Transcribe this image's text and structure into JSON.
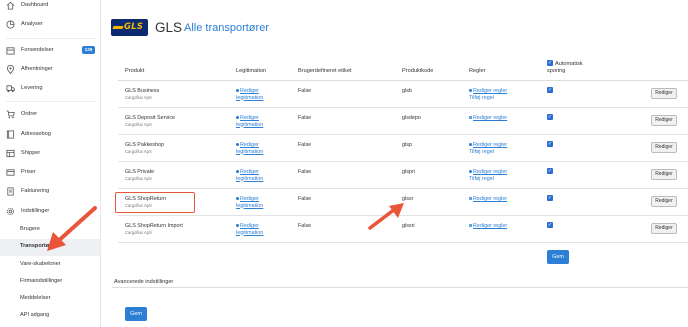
{
  "sidebar": {
    "items": [
      {
        "label": "Dashboard",
        "icon": "home-icon"
      },
      {
        "label": "Analyser",
        "icon": "chart-icon"
      },
      {
        "label": "Forsendelser",
        "icon": "box-icon",
        "badge": "129"
      },
      {
        "label": "Afhentninger",
        "icon": "pin-icon"
      },
      {
        "label": "Levering",
        "icon": "truck-icon"
      },
      {
        "label": "Ordrer",
        "icon": "cart-icon"
      },
      {
        "label": "Adressebog",
        "icon": "book-icon"
      },
      {
        "label": "Shipper",
        "icon": "shipper-icon"
      },
      {
        "label": "Priser",
        "icon": "price-icon"
      },
      {
        "label": "Fakturering",
        "icon": "invoice-icon"
      },
      {
        "label": "Indstillinger",
        "icon": "gear-icon"
      }
    ],
    "subitems": [
      {
        "label": "Brugere"
      },
      {
        "label": "Transportører",
        "active": true
      },
      {
        "label": "Vare-skabeloner"
      },
      {
        "label": "Firmaindstillinger"
      },
      {
        "label": "Meddelelser"
      },
      {
        "label": "API adgang"
      }
    ]
  },
  "header": {
    "logo_text": "GLS",
    "title": "GLS",
    "subtitle": "Alle transportører"
  },
  "table": {
    "headers": {
      "produkt": "Produkt",
      "legitimation": "Legitimation",
      "brugerdefineret": "Brugerdefineret etiket",
      "produktkode": "Produktkode",
      "regler": "Regler",
      "automatisk": "Automatisk",
      "sporing": "sporing"
    },
    "rows": [
      {
        "name": "GLS Business",
        "carrier": "Cargoflux ApS",
        "leg1": "Rediger",
        "leg2": "legitimation",
        "custom": "False",
        "code": "glsb",
        "rule1": "Rediger regler",
        "rule2": "Tilføj regel",
        "rule_filled": true,
        "tracking": true,
        "action": "Rediger"
      },
      {
        "name": "GLS Deposit Service",
        "carrier": "Cargoflux ApS",
        "leg1": "Rediger",
        "leg2": "legitimation",
        "custom": "False",
        "code": "glsdepo",
        "rule1": "Rediger regler",
        "rule2": "",
        "rule_filled": false,
        "tracking": true,
        "action": "Rediger"
      },
      {
        "name": "GLS Pakkeshop",
        "carrier": "Cargoflux ApS",
        "leg1": "Rediger",
        "leg2": "legitimation",
        "custom": "False",
        "code": "glsp",
        "rule1": "Rediger regler",
        "rule2": "Tilføj regel",
        "rule_filled": true,
        "tracking": true,
        "action": "Rediger"
      },
      {
        "name": "GLS Private",
        "carrier": "Cargoflux ApS",
        "leg1": "Rediger",
        "leg2": "legitimation",
        "custom": "False",
        "code": "glspri",
        "rule1": "Rediger regler",
        "rule2": "Tilføj regel",
        "rule_filled": true,
        "tracking": true,
        "action": "Rediger"
      },
      {
        "name": "GLS ShopReturn",
        "carrier": "Cargoflux ApS",
        "leg1": "Rediger",
        "leg2": "legitimation",
        "custom": "False",
        "code": "glssr",
        "rule1": "Rediger regler",
        "rule2": "",
        "rule_filled": false,
        "tracking": true,
        "action": "Rediger"
      },
      {
        "name": "GLS ShopReturn Import",
        "carrier": "Cargoflux ApS",
        "leg1": "Rediger",
        "leg2": "legitimation",
        "custom": "False",
        "code": "glssri",
        "rule1": "Rediger regler",
        "rule2": "",
        "rule_filled": false,
        "tracking": true,
        "action": "Rediger"
      }
    ],
    "save_label": "Gem"
  },
  "advanced": {
    "label": "Avancerede indstillinger",
    "save_label": "Gem"
  },
  "colors": {
    "accent": "#2b7fd5",
    "annotation": "#e8553a",
    "gls_blue": "#0b2a6f",
    "gls_yellow": "#f2b705"
  }
}
